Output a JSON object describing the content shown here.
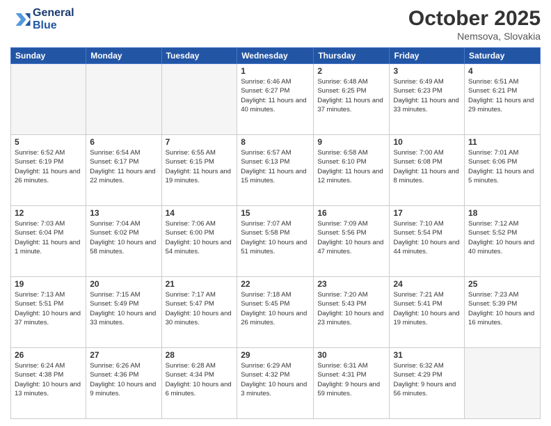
{
  "header": {
    "logo_line1": "General",
    "logo_line2": "Blue",
    "month": "October 2025",
    "location": "Nemsova, Slovakia"
  },
  "weekdays": [
    "Sunday",
    "Monday",
    "Tuesday",
    "Wednesday",
    "Thursday",
    "Friday",
    "Saturday"
  ],
  "weeks": [
    [
      {
        "day": "",
        "info": ""
      },
      {
        "day": "",
        "info": ""
      },
      {
        "day": "",
        "info": ""
      },
      {
        "day": "1",
        "info": "Sunrise: 6:46 AM\nSunset: 6:27 PM\nDaylight: 11 hours\nand 40 minutes."
      },
      {
        "day": "2",
        "info": "Sunrise: 6:48 AM\nSunset: 6:25 PM\nDaylight: 11 hours\nand 37 minutes."
      },
      {
        "day": "3",
        "info": "Sunrise: 6:49 AM\nSunset: 6:23 PM\nDaylight: 11 hours\nand 33 minutes."
      },
      {
        "day": "4",
        "info": "Sunrise: 6:51 AM\nSunset: 6:21 PM\nDaylight: 11 hours\nand 29 minutes."
      }
    ],
    [
      {
        "day": "5",
        "info": "Sunrise: 6:52 AM\nSunset: 6:19 PM\nDaylight: 11 hours\nand 26 minutes."
      },
      {
        "day": "6",
        "info": "Sunrise: 6:54 AM\nSunset: 6:17 PM\nDaylight: 11 hours\nand 22 minutes."
      },
      {
        "day": "7",
        "info": "Sunrise: 6:55 AM\nSunset: 6:15 PM\nDaylight: 11 hours\nand 19 minutes."
      },
      {
        "day": "8",
        "info": "Sunrise: 6:57 AM\nSunset: 6:13 PM\nDaylight: 11 hours\nand 15 minutes."
      },
      {
        "day": "9",
        "info": "Sunrise: 6:58 AM\nSunset: 6:10 PM\nDaylight: 11 hours\nand 12 minutes."
      },
      {
        "day": "10",
        "info": "Sunrise: 7:00 AM\nSunset: 6:08 PM\nDaylight: 11 hours\nand 8 minutes."
      },
      {
        "day": "11",
        "info": "Sunrise: 7:01 AM\nSunset: 6:06 PM\nDaylight: 11 hours\nand 5 minutes."
      }
    ],
    [
      {
        "day": "12",
        "info": "Sunrise: 7:03 AM\nSunset: 6:04 PM\nDaylight: 11 hours\nand 1 minute."
      },
      {
        "day": "13",
        "info": "Sunrise: 7:04 AM\nSunset: 6:02 PM\nDaylight: 10 hours\nand 58 minutes."
      },
      {
        "day": "14",
        "info": "Sunrise: 7:06 AM\nSunset: 6:00 PM\nDaylight: 10 hours\nand 54 minutes."
      },
      {
        "day": "15",
        "info": "Sunrise: 7:07 AM\nSunset: 5:58 PM\nDaylight: 10 hours\nand 51 minutes."
      },
      {
        "day": "16",
        "info": "Sunrise: 7:09 AM\nSunset: 5:56 PM\nDaylight: 10 hours\nand 47 minutes."
      },
      {
        "day": "17",
        "info": "Sunrise: 7:10 AM\nSunset: 5:54 PM\nDaylight: 10 hours\nand 44 minutes."
      },
      {
        "day": "18",
        "info": "Sunrise: 7:12 AM\nSunset: 5:52 PM\nDaylight: 10 hours\nand 40 minutes."
      }
    ],
    [
      {
        "day": "19",
        "info": "Sunrise: 7:13 AM\nSunset: 5:51 PM\nDaylight: 10 hours\nand 37 minutes."
      },
      {
        "day": "20",
        "info": "Sunrise: 7:15 AM\nSunset: 5:49 PM\nDaylight: 10 hours\nand 33 minutes."
      },
      {
        "day": "21",
        "info": "Sunrise: 7:17 AM\nSunset: 5:47 PM\nDaylight: 10 hours\nand 30 minutes."
      },
      {
        "day": "22",
        "info": "Sunrise: 7:18 AM\nSunset: 5:45 PM\nDaylight: 10 hours\nand 26 minutes."
      },
      {
        "day": "23",
        "info": "Sunrise: 7:20 AM\nSunset: 5:43 PM\nDaylight: 10 hours\nand 23 minutes."
      },
      {
        "day": "24",
        "info": "Sunrise: 7:21 AM\nSunset: 5:41 PM\nDaylight: 10 hours\nand 19 minutes."
      },
      {
        "day": "25",
        "info": "Sunrise: 7:23 AM\nSunset: 5:39 PM\nDaylight: 10 hours\nand 16 minutes."
      }
    ],
    [
      {
        "day": "26",
        "info": "Sunrise: 6:24 AM\nSunset: 4:38 PM\nDaylight: 10 hours\nand 13 minutes."
      },
      {
        "day": "27",
        "info": "Sunrise: 6:26 AM\nSunset: 4:36 PM\nDaylight: 10 hours\nand 9 minutes."
      },
      {
        "day": "28",
        "info": "Sunrise: 6:28 AM\nSunset: 4:34 PM\nDaylight: 10 hours\nand 6 minutes."
      },
      {
        "day": "29",
        "info": "Sunrise: 6:29 AM\nSunset: 4:32 PM\nDaylight: 10 hours\nand 3 minutes."
      },
      {
        "day": "30",
        "info": "Sunrise: 6:31 AM\nSunset: 4:31 PM\nDaylight: 9 hours\nand 59 minutes."
      },
      {
        "day": "31",
        "info": "Sunrise: 6:32 AM\nSunset: 4:29 PM\nDaylight: 9 hours\nand 56 minutes."
      },
      {
        "day": "",
        "info": ""
      }
    ]
  ]
}
